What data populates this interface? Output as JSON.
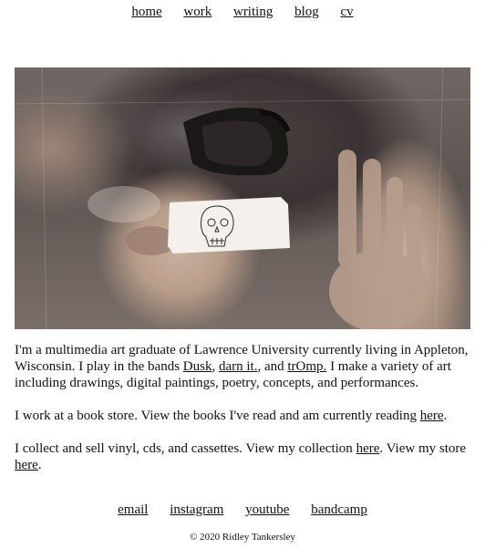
{
  "nav": {
    "items": [
      "home",
      "work",
      "writing",
      "blog",
      "cv"
    ]
  },
  "hero": {
    "alt": "photo of a person behind glass holding up a sketched skull drawing"
  },
  "bio": {
    "p1_intro": "I'm a multimedia art graduate of Lawrence University currently living in Appleton, Wisconsin. I play in the bands ",
    "band1": "Dusk",
    "sep1": ", ",
    "band2": "darn it.",
    "sep2": ", and ",
    "band3": "trOmp.",
    "p1_outro": " I make a variety of art including drawings, digital paintings, poetry, concepts, and performances.",
    "p2_text": "I work at a book store. View the books I've read and am currently reading ",
    "p2_link": "here",
    "p2_end": ".",
    "p3_text": "I collect and sell vinyl, cds, and cassettes. View my collection ",
    "p3_link1": "here",
    "p3_mid": ". View my store ",
    "p3_link2": "here",
    "p3_end": "."
  },
  "social": {
    "items": [
      "email",
      "instagram",
      "youtube",
      "bandcamp"
    ]
  },
  "footer": {
    "copyright": "© 2020 Ridley Tankersley"
  }
}
